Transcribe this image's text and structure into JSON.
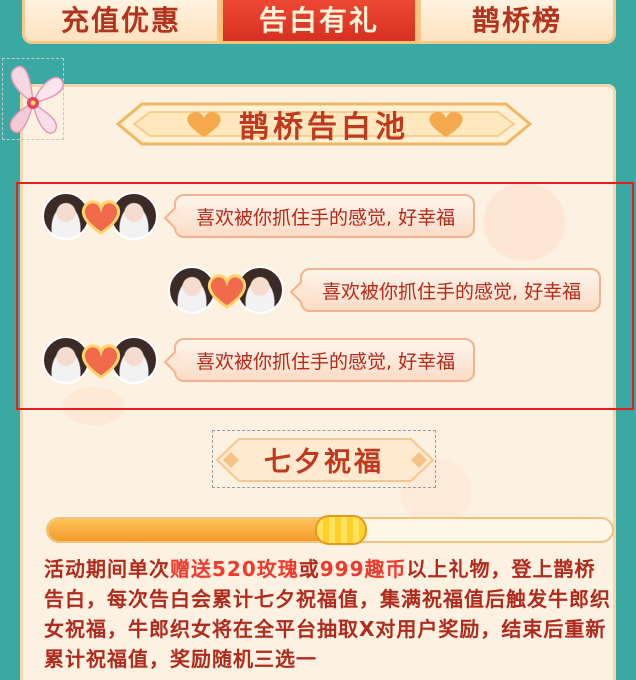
{
  "tabs": [
    {
      "label": "充值优惠",
      "active": false
    },
    {
      "label": "告白有礼",
      "active": true
    },
    {
      "label": "鹊桥榜",
      "active": false
    }
  ],
  "banner": {
    "title": "鹊桥告白池"
  },
  "confessions": [
    {
      "message": "喜欢被你抓住手的感觉, 好幸福"
    },
    {
      "message": "喜欢被你抓住手的感觉, 好幸福"
    },
    {
      "message": "喜欢被你抓住手的感觉, 好幸福"
    }
  ],
  "blessing": {
    "title": "七夕祝福",
    "progress": 0.52
  },
  "description": {
    "p1": "活动期间单次",
    "h1": "赠送520玫瑰",
    "p2": "或",
    "h2": "999趣币",
    "p3": "以上礼物，登上鹊桥告白，每次告白会累计七夕祝福值，集满祝福值后触发牛郎织女祝福，牛郎织女将在全平台抽取X对用户奖励，结束后重新累计祝福值，奖励随机三选一"
  },
  "colors": {
    "background": "#3aa9a3",
    "accent_red": "#c0391f",
    "highlight": "#ef3a2d",
    "active_tab": "#e23c2a"
  },
  "icons": [
    "flower-icon",
    "heart-icon",
    "left-heart-icon",
    "right-heart-icon"
  ]
}
